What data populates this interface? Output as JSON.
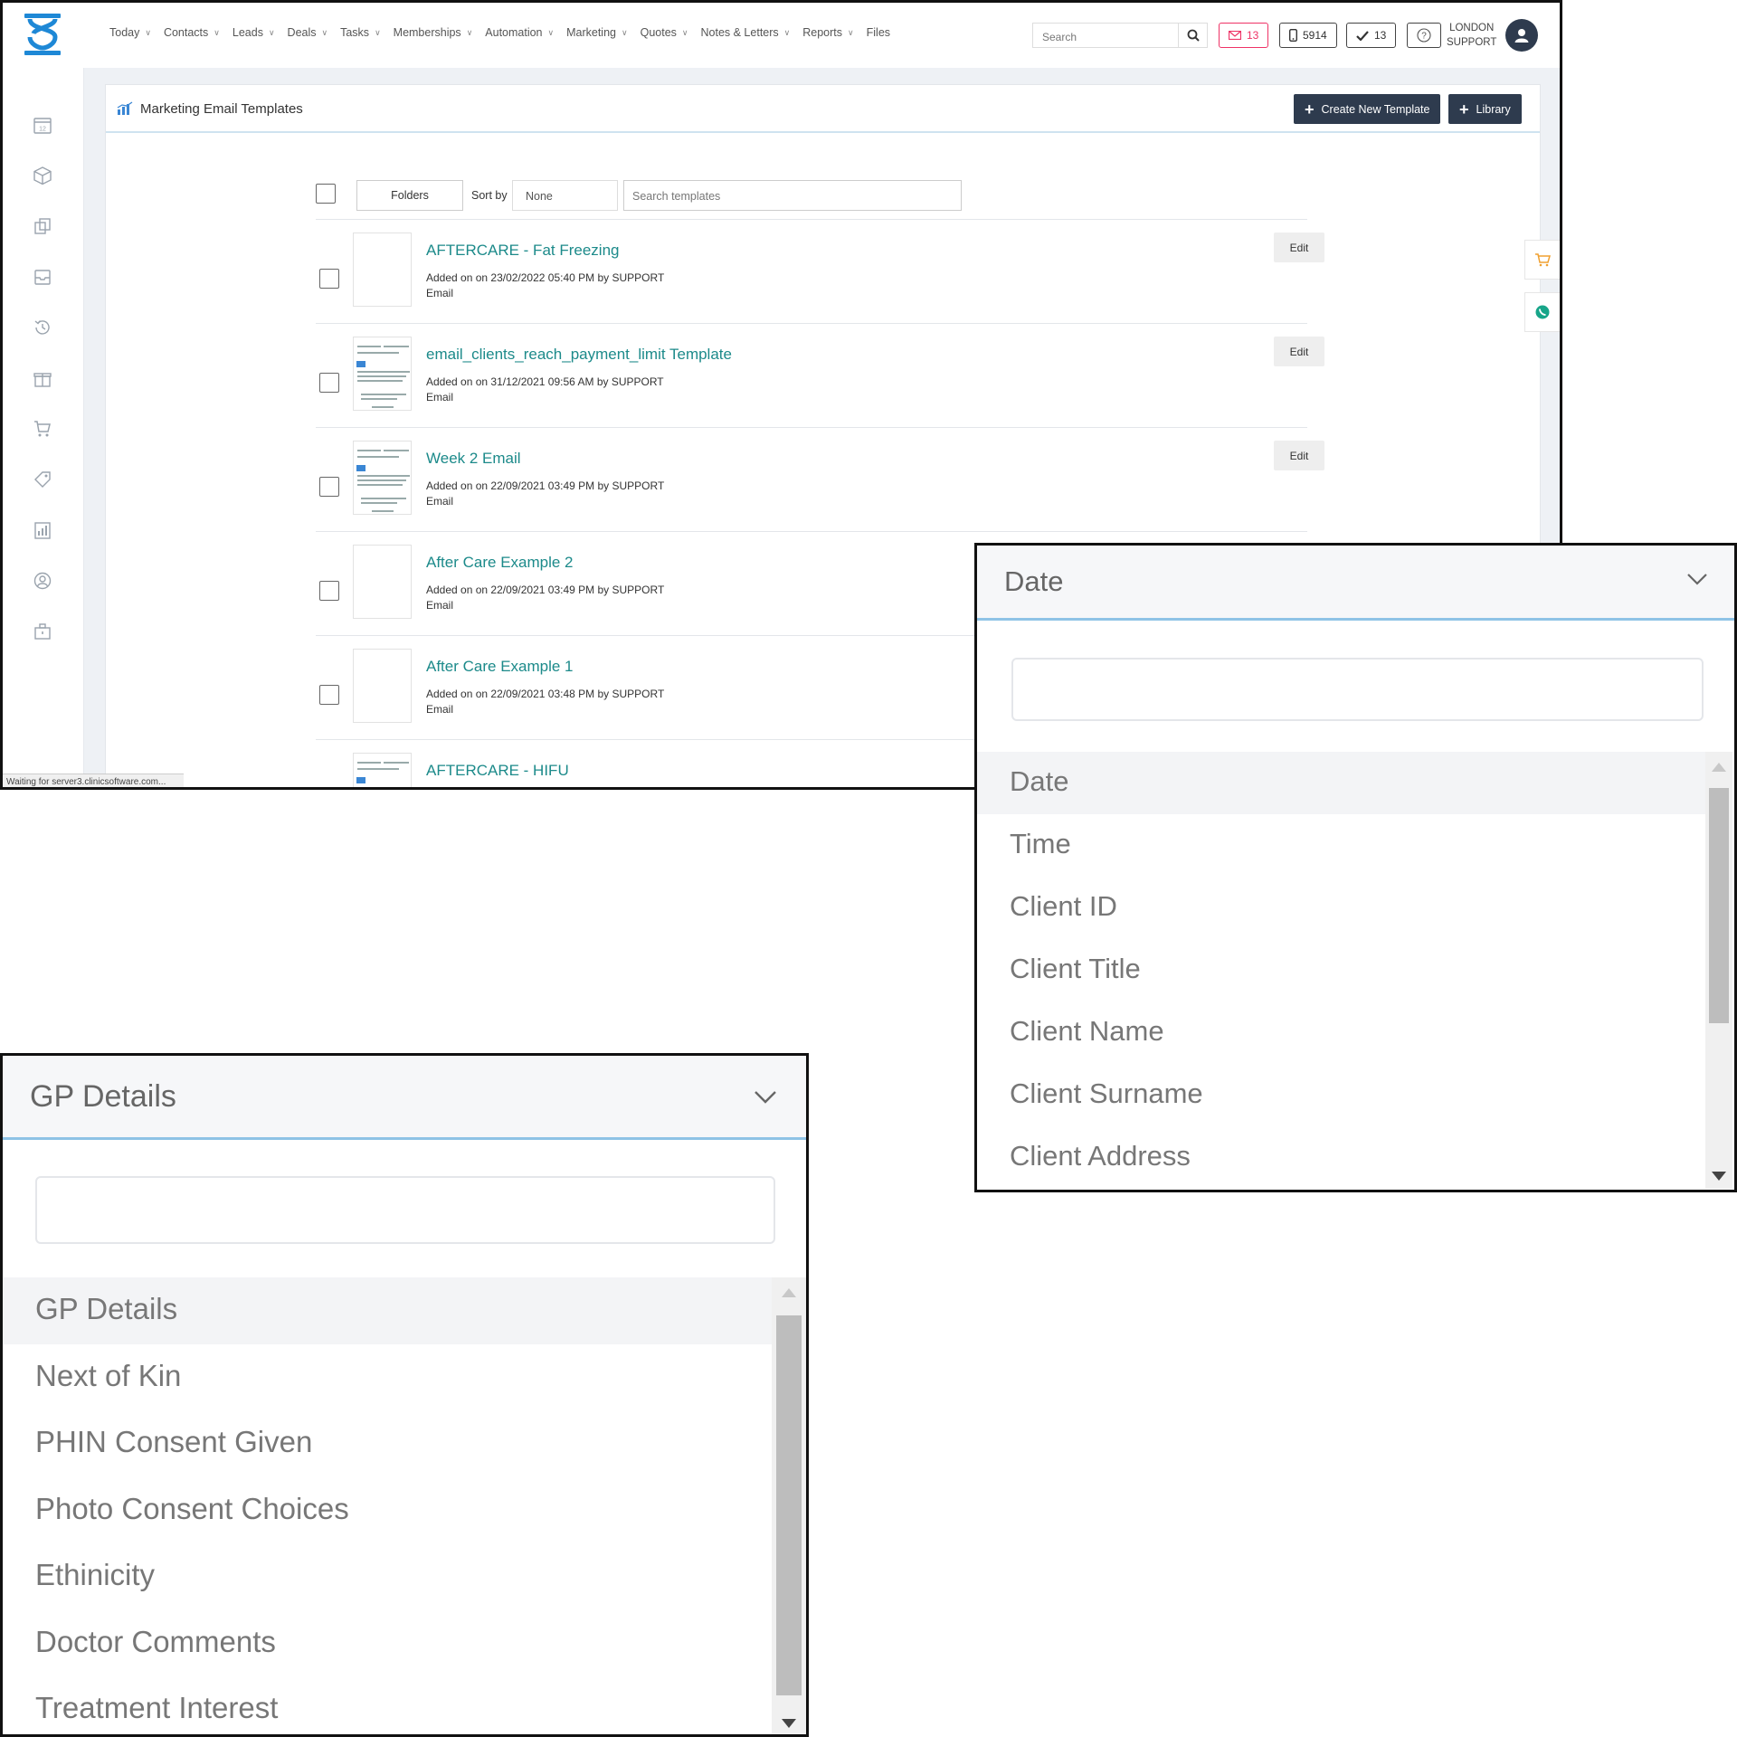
{
  "nav": {
    "items": [
      {
        "label": "Today",
        "dropdown": true
      },
      {
        "label": "Contacts",
        "dropdown": true
      },
      {
        "label": "Leads",
        "dropdown": true
      },
      {
        "label": "Deals",
        "dropdown": true
      },
      {
        "label": "Tasks",
        "dropdown": true
      },
      {
        "label": "Memberships",
        "dropdown": true
      },
      {
        "label": "Automation",
        "dropdown": true
      },
      {
        "label": "Marketing",
        "dropdown": true
      },
      {
        "label": "Quotes",
        "dropdown": true
      },
      {
        "label": "Notes & Letters",
        "dropdown": true
      },
      {
        "label": "Reports",
        "dropdown": true
      },
      {
        "label": "Files",
        "dropdown": false
      }
    ],
    "search_placeholder": "Search",
    "mail_count": "13",
    "phone_count": "5914",
    "task_count": "13",
    "user_line1": "LONDON",
    "user_line2": "SUPPORT"
  },
  "sidebar": {
    "icons": [
      "calendar-icon",
      "box-icon",
      "copy-icon",
      "inbox-icon",
      "history-icon",
      "gift-icon",
      "cart-icon",
      "tag-icon",
      "report-icon",
      "user-circle-icon",
      "briefcase-icon"
    ],
    "calendar_day": "12"
  },
  "page": {
    "title": "Marketing Email Templates",
    "create_label": "Create New Template",
    "library_label": "Library",
    "folders_label": "Folders",
    "sortby_label": "Sort by",
    "sort_value": "None",
    "search_placeholder": "Search templates"
  },
  "templates": [
    {
      "name": "AFTERCARE - Fat Freezing",
      "meta": "Added on on 23/02/2022 05:40 PM by SUPPORT",
      "type": "Email",
      "edit": "Edit",
      "thumb": false
    },
    {
      "name": "email_clients_reach_payment_limit Template",
      "meta": "Added on on 31/12/2021 09:56 AM by SUPPORT",
      "type": "Email",
      "edit": "Edit",
      "thumb": true
    },
    {
      "name": "Week 2 Email",
      "meta": "Added on on 22/09/2021 03:49 PM by SUPPORT",
      "type": "Email",
      "edit": "Edit",
      "thumb": true
    },
    {
      "name": "After Care Example 2",
      "meta": "Added on on 22/09/2021 03:49 PM by SUPPORT",
      "type": "Email",
      "edit": "",
      "thumb": false
    },
    {
      "name": "After Care Example 1",
      "meta": "Added on on 22/09/2021 03:48 PM by SUPPORT",
      "type": "Email",
      "edit": "",
      "thumb": false
    },
    {
      "name": "AFTERCARE - HIFU",
      "meta": "",
      "type": "",
      "edit": "",
      "thumb": true
    }
  ],
  "status_bar": "Waiting for server3.clinicsoftware.com...",
  "date_dropdown": {
    "selected": "Date",
    "options": [
      "Date",
      "Time",
      "Client ID",
      "Client Title",
      "Client Name",
      "Client Surname",
      "Client Address"
    ]
  },
  "gp_dropdown": {
    "selected": "GP Details",
    "options": [
      "GP Details",
      "Next of Kin",
      "PHIN Consent Given",
      "Photo Consent Choices",
      "Ethinicity",
      "Doctor Comments",
      "Treatment Interest"
    ]
  },
  "colors": {
    "accent_dark": "#2e3b4e",
    "link_teal": "#1c8a8a",
    "logo_blue": "#1e88d6",
    "focus_blue": "#8ec3e6",
    "mail_red": "#e36"
  }
}
